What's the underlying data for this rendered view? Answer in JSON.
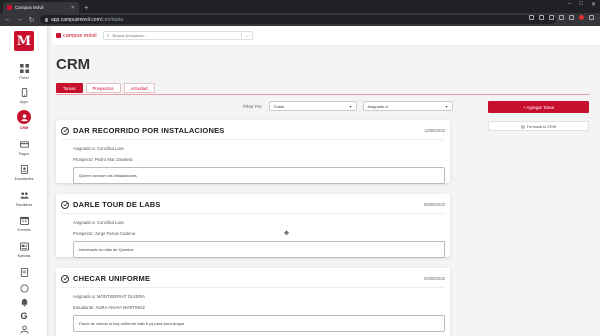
{
  "browser": {
    "tab_title": "Campus Móvil",
    "url_host": "app.campusmovil.com",
    "url_path": "/crm/tasks"
  },
  "topbar": {
    "brand": "campus móvil",
    "search_placeholder": "Buscar prospecto..."
  },
  "sidebar": {
    "logo": "M",
    "items": [
      {
        "label": "Panel",
        "icon": "grid-icon"
      },
      {
        "label": "Apps",
        "icon": "phone-icon"
      },
      {
        "label": "CRM",
        "icon": "crm-icon"
      },
      {
        "label": "Pagos",
        "icon": "card-icon"
      },
      {
        "label": "Estudiantes",
        "icon": "student-icon"
      },
      {
        "label": "Familiares",
        "icon": "family-icon"
      },
      {
        "label": "Eventos",
        "icon": "calendar-icon"
      },
      {
        "label": "Noticias",
        "icon": "news-icon"
      }
    ]
  },
  "page": {
    "title": "CRM",
    "tabs": [
      "Tareas",
      "Prospectos",
      "Actividad"
    ],
    "filter_label": "Filtrar Por:",
    "filter_select": "Todas",
    "assigned_select": "Asignado a:",
    "add_task": "+ Agregar Tarea",
    "crm_form": "Formulario CRM"
  },
  "tasks": [
    {
      "title": "DAR RECORRIDO POR INSTALACIONES",
      "date": "12/05/2022",
      "assigned": "Asignado a: Conchita Lara",
      "person": "Prospecto: Pedro Mar Zavaleta",
      "note": "Quiere conocer las instalaciones"
    },
    {
      "title": "DARLE TOUR DE LABS",
      "date": "06/05/2022",
      "assigned": "Asignado a: Conchita Lara",
      "person": "Prospecto: Jorge Farías Cadena",
      "note": "Interesado en labs de Química"
    },
    {
      "title": "CHECAR UNIFORME",
      "date": "04/05/2022",
      "assigned": "Asignado a: MONTSERRAT OLVERA",
      "person": "Estudiante: AURA ANAYA MARTINEZ",
      "note": "Favor de checar si hay uniforme talla 6 ya para Aura Anaya"
    }
  ],
  "colors": {
    "accent": "#c8102e"
  }
}
